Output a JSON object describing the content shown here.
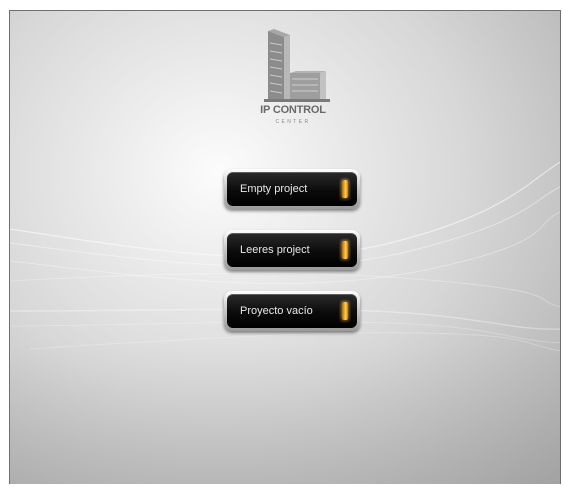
{
  "logo": {
    "title": "IP CONTROL",
    "subtitle": "CENTER",
    "icon": "building-icon"
  },
  "projects": [
    {
      "label": "Empty project",
      "indicator_icon": "status-led-icon"
    },
    {
      "label": "Leeres project",
      "indicator_icon": "status-led-icon"
    },
    {
      "label": "Proyecto vacío",
      "indicator_icon": "status-led-icon"
    }
  ],
  "colors": {
    "led": "#ffb21a",
    "button_face": "#0b0b0b",
    "background": "#d7d7d7"
  }
}
